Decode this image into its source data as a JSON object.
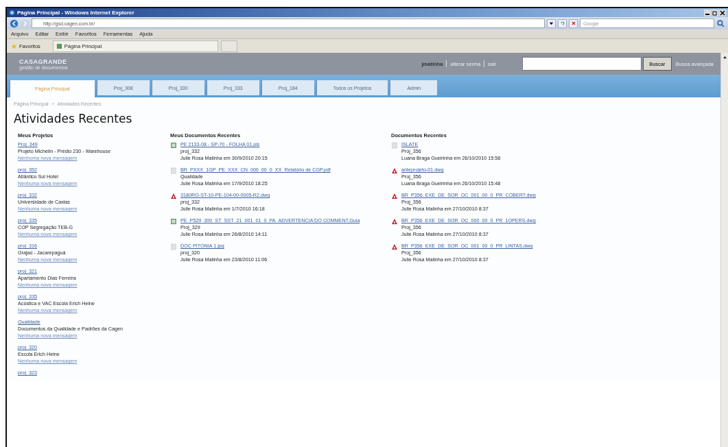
{
  "window": {
    "title": "Página Principal - Windows Internet Explorer"
  },
  "address_bar": {
    "url": "http://gsd.cagen.com.br/",
    "search_placeholder": "Google"
  },
  "menu": [
    "Arquivo",
    "Editar",
    "Exibir",
    "Favoritos",
    "Ferramentas",
    "Ajuda"
  ],
  "favorites_bar": {
    "label": "Favoritos",
    "tab": "Página Principal"
  },
  "site_header": {
    "logo": "CASAGRANDE",
    "logo_subtitle": "gestão de documentos",
    "user_links": [
      "jmatinha",
      "alterar senha",
      "sair"
    ],
    "search_button": "Buscar",
    "advanced_search": "Busca avançada"
  },
  "tabs": [
    {
      "label": "Página Principal",
      "selected": true
    },
    {
      "label": "Proj_308",
      "selected": false
    },
    {
      "label": "Proj_330",
      "selected": false
    },
    {
      "label": "Proj_333",
      "selected": false
    },
    {
      "label": "Proj_184",
      "selected": false
    },
    {
      "label": "Todos os Projetos",
      "selected": false
    },
    {
      "label": "Admin",
      "selected": false
    }
  ],
  "breadcrumb": [
    "Página Principal",
    "Atividades Recentes"
  ],
  "page_title": "Atividades Recentes",
  "my_projects": {
    "title": "Meus Projetos",
    "items": [
      {
        "code": "Proj_349",
        "name": "Projeto Michelin - Prédio 230 - Warehouse",
        "messages": "Nenhuma nova mensagem"
      },
      {
        "code": "proj_352",
        "name": "Atlântico Sul Hotel",
        "messages": "Nenhuma nova mensagem"
      },
      {
        "code": "proj_332",
        "name": "Universidade de Caxias",
        "messages": "Nenhuma nova mensagem"
      },
      {
        "code": "proj_335",
        "name": "COP Segregação TEB-G",
        "messages": "Nenhuma nova mensagem"
      },
      {
        "code": "proj_316",
        "name": "Grajaú - Jacarepaguá",
        "messages": "Nenhuma nova mensagem"
      },
      {
        "code": "proj_321",
        "name": "Apartamento Dias Ferreira",
        "messages": "Nenhuma nova mensagem"
      },
      {
        "code": "proj_335",
        "name": "Acústica e VAC Escola Erich Heine",
        "messages": "Nenhuma nova mensagem"
      },
      {
        "code": "Qualidade",
        "name": "Documentos da Qualidade e Padrões da Cagen",
        "messages": "Nenhuma nova mensagem"
      },
      {
        "code": "proj_320",
        "name": "Escola Erich Heine",
        "messages": "Nenhuma nova mensagem"
      },
      {
        "code": "proj_323"
      }
    ]
  },
  "my_documents": {
    "title": "Meus Documentos Recentes",
    "items": [
      {
        "kind": "image",
        "file": "PE 2133-08 - SP-70 - FOLHA 01.pls",
        "project": "proj_332",
        "author": "Julie Rosa Malinha em 30/9/2010 20:15"
      },
      {
        "kind": "file",
        "file": "BR_PXXX_1GP_PE_XXX_CN_000_00_0_XX_Relatório de CGP.pdf",
        "project": "Qualidade",
        "author": "Julie Rosa Malinha em 17/9/2010 18:25"
      },
      {
        "kind": "dwg",
        "file": "3180RO-ST-10-PE-104-00-0005-R2.dwg",
        "project": "proj_332",
        "author": "Julie Rosa Malinha em 1/7/2010 16:18"
      },
      {
        "kind": "image",
        "file": "PE_P529_300_ST_SST_21_001_01_0_PA_ADVERTENCIA DO COMMENT.Guia",
        "project": "Proj_329",
        "author": "Julie Rosa Malinha em 26/8/2010 14:11"
      },
      {
        "kind": "file",
        "file": "DOC PITONIA 1.jpg",
        "project": "proj_320",
        "author": "Julie Rosa Malinha em 23/8/2010 11:06"
      }
    ]
  },
  "recent_documents": {
    "title": "Documentos Recentes",
    "items": [
      {
        "kind": "file",
        "file": "ISLATE",
        "project": "Proj_356",
        "author": "Luana Braga Gueirinha em 26/10/2010 15:58"
      },
      {
        "kind": "dwg",
        "file": "anteprojeto-01.dwg",
        "project": "Proj_356",
        "author": "Luana Braga Gueirinha em 26/10/2010 15:48"
      },
      {
        "kind": "dwg",
        "file": "BR_P356_EXE_DE_SOR_OC_001_00_0_PR_COBERT.dwg",
        "project": "Proj_356",
        "author": "Julie Rosa Malinha em 27/10/2010 8:37"
      },
      {
        "kind": "dwg",
        "file": "BR_P356_EXE_DE_SOR_OC_000_00_0_PR_1OPERS.dwg",
        "project": "Proj_356",
        "author": "Julie Rosa Malinha em 27/10/2010 8:37"
      },
      {
        "kind": "dwg",
        "file": "BR_P356_EXE_DE_SOR_OC_001_00_0_PR_LINTAS.dwg",
        "project": "Proj_356",
        "author": "Julie Rosa Malinha em 27/10/2010 8:37"
      }
    ]
  }
}
